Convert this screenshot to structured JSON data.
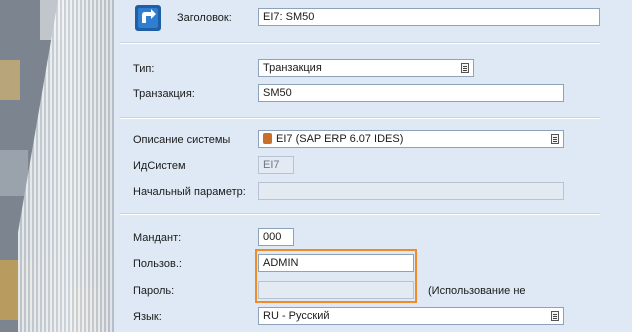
{
  "form": {
    "title_label": "Заголовок:",
    "title_value": "EI7: SM50",
    "type_label": "Тип:",
    "type_value": "Транзакция",
    "transaction_label": "Транзакция:",
    "transaction_value": "SM50",
    "system_desc_label": "Описание системы",
    "system_desc_value": "EI7 (SAP ERP 6.07 IDES)",
    "system_id_label": "ИдСистем",
    "system_id_value": "EI7",
    "start_param_label": "Начальный параметр:",
    "start_param_value": "",
    "client_label": "Мандант:",
    "client_value": "000",
    "user_label": "Пользов.:",
    "user_value": "ADMIN",
    "password_label": "Пароль:",
    "password_value": "",
    "password_note": "(Использование не",
    "language_label": "Язык:",
    "language_value": "RU - Русский"
  },
  "icons": {
    "logo": "sap-shortcut-logo-icon",
    "dropdown": "dropdown-icon",
    "system": "sap-system-icon"
  },
  "colors": {
    "panel_bg": "#dfe9f5",
    "highlight": "#f08c28",
    "logo_blue": "#1f5fa8"
  }
}
